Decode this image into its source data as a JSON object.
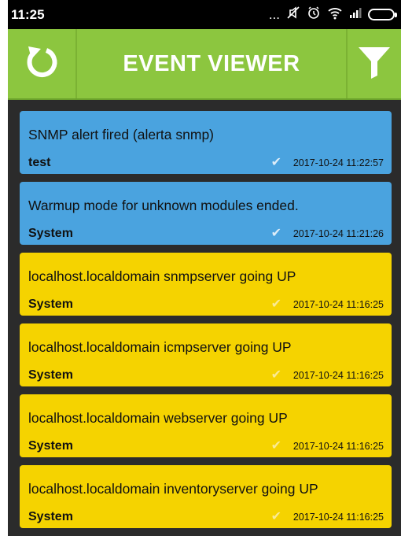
{
  "status_bar": {
    "time": "11:25",
    "dots": "...",
    "icons": [
      "mute-icon",
      "alarm-icon",
      "wifi-icon",
      "signal-icon",
      "battery-icon"
    ]
  },
  "app_bar": {
    "title": "EVENT VIEWER",
    "background": "#8cc63f",
    "refresh_icon": "refresh-icon",
    "filter_icon": "filter-funnel-icon"
  },
  "colors": {
    "info": "#4aa3df",
    "warning": "#f5d300"
  },
  "events": [
    {
      "message": "SNMP alert fired (alerta snmp)",
      "source": "test",
      "timestamp": "2017-10-24 11:22:57",
      "color": "blue"
    },
    {
      "message": "Warmup mode for unknown modules ended.",
      "source": "System",
      "timestamp": "2017-10-24 11:21:26",
      "color": "blue"
    },
    {
      "message": "localhost.localdomain snmpserver going UP",
      "source": "System",
      "timestamp": "2017-10-24 11:16:25",
      "color": "yellow"
    },
    {
      "message": "localhost.localdomain icmpserver going UP",
      "source": "System",
      "timestamp": "2017-10-24 11:16:25",
      "color": "yellow"
    },
    {
      "message": "localhost.localdomain webserver going UP",
      "source": "System",
      "timestamp": "2017-10-24 11:16:25",
      "color": "yellow"
    },
    {
      "message": "localhost.localdomain inventoryserver going UP",
      "source": "System",
      "timestamp": "2017-10-24 11:16:25",
      "color": "yellow"
    }
  ]
}
